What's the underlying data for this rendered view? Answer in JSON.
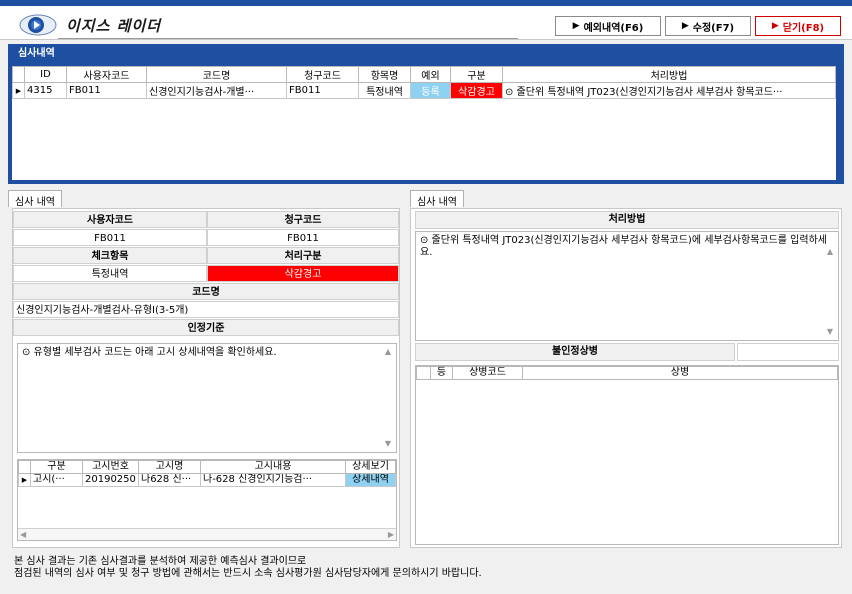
{
  "app": {
    "title": "이지스 레이더"
  },
  "header": {
    "btn_exception": "예외내역(F6)",
    "btn_edit": "수정(F7)",
    "btn_close": "닫기(F8)"
  },
  "review": {
    "title": "심사내역",
    "columns": [
      "ID",
      "사용자코드",
      "코드명",
      "청구코드",
      "항목명",
      "예외",
      "구분",
      "처리방법"
    ],
    "row": {
      "marker": "▶",
      "id": "4315",
      "user_code": "FB011",
      "code_name": "신경인지기능검사-개별···",
      "claim_code": "FB011",
      "item_name": "특정내역",
      "exception": "등록",
      "category": "삭감경고",
      "method": "⊙ 줄단위 특정내역 JT023(신경인지기능검사 세부검사 항목코드···"
    }
  },
  "left": {
    "tab": "심사 내역",
    "user_code_label": "사용자코드",
    "claim_code_label": "청구코드",
    "user_code": "FB011",
    "claim_code": "FB011",
    "check_item_label": "체크항목",
    "process_type_label": "처리구분",
    "check_item": "특정내역",
    "process_type": "삭감경고",
    "code_name_label": "코드명",
    "code_name": "신경인지기능검사-개별검사-유형Ⅰ(3-5개)",
    "criteria_label": "인정기준",
    "criteria_text": "⊙ 유형별 세부검사 코드는 아래 고시 상세내역을 확인하세요.",
    "notice_columns": [
      "구분",
      "고시번호",
      "고시명",
      "고시내용",
      "상세보기"
    ],
    "notice_row": {
      "marker": "▶",
      "type": "고시(···",
      "number": "20190250",
      "name": "나628 신···",
      "content": "나-628 신경인지기능검···",
      "detail": "상세내역"
    }
  },
  "right": {
    "tab": "심사 내역",
    "method_label": "처리방법",
    "method_text": "⊙ 줄단위 특정내역 JT023(신경인지기능검사 세부검사 항목코드)에 세부검사항목코드를 입력하세요.",
    "disease_label": "불인정상병",
    "disease_columns": [
      "등",
      "상병코드",
      "상병"
    ]
  },
  "footer": {
    "line1": "본 심사 결과는 기존 심사결과를 분석하여 제공한 예측심사 결과이므로",
    "line2": "점검된 내역의 심사 여부 및 청구 방법에 관해서는 반드시 소속 심사평가원 심사담당자에게 문의하시기 바랍니다."
  },
  "colors": {
    "accent": "#1e4fa0",
    "alert": "#ff0000",
    "badge": "#8fd1f0"
  }
}
